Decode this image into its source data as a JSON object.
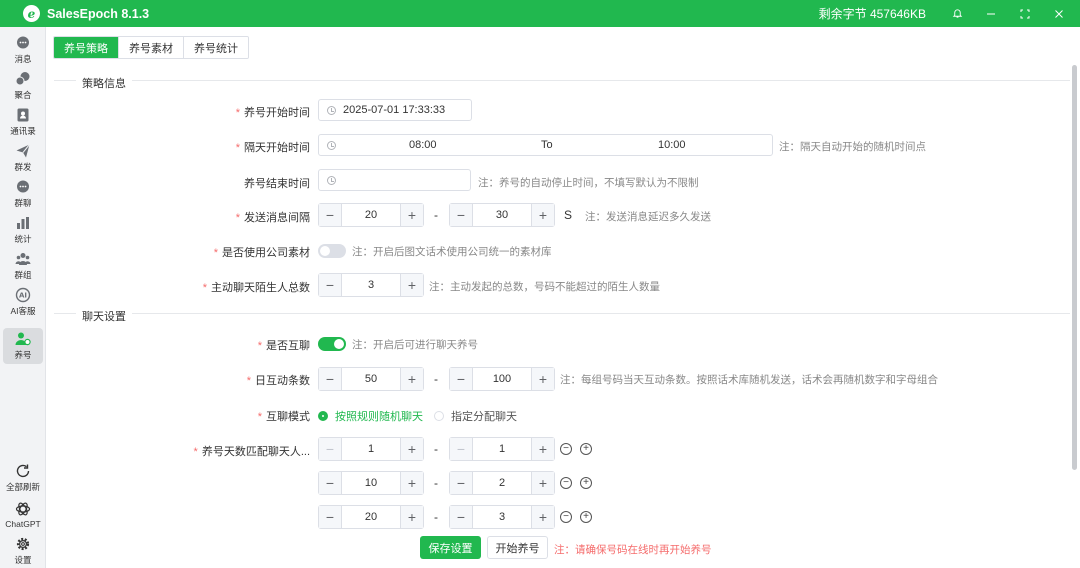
{
  "titlebar": {
    "app_title": "SalesEpoch 8.1.3",
    "logo_letter": "e",
    "bytes_label": "剩余字节",
    "bytes_value": "457646KB"
  },
  "sidebar": {
    "items": [
      {
        "label": "消息",
        "icon": "chat-bubble-icon"
      },
      {
        "label": "聚合",
        "icon": "aggregate-chat-icon"
      },
      {
        "label": "通讯录",
        "icon": "contacts-book-icon"
      },
      {
        "label": "群发",
        "icon": "send-plane-icon"
      },
      {
        "label": "群聊",
        "icon": "group-chat-icon"
      },
      {
        "label": "统计",
        "icon": "bar-chart-icon"
      },
      {
        "label": "群组",
        "icon": "people-group-icon"
      },
      {
        "label": "AI客服",
        "icon": "ai-robot-icon"
      },
      {
        "label": "养号",
        "icon": "user-add-icon"
      }
    ],
    "bottom": [
      {
        "label": "全部刷新",
        "icon": "refresh-icon"
      },
      {
        "label": "ChatGPT",
        "icon": "chatgpt-icon"
      },
      {
        "label": "设置",
        "icon": "gear-icon"
      }
    ]
  },
  "tabs": [
    "养号策略",
    "养号素材",
    "养号统计"
  ],
  "strategy": {
    "section_title": "策略信息",
    "start_time": {
      "label": "养号开始时间",
      "value": "2025-07-01 17:33:33"
    },
    "next_day": {
      "label": "隔天开始时间",
      "from": "08:00",
      "sep": "To",
      "to": "10:00",
      "note": "注：隔天自动开始的随机时间点"
    },
    "end_time": {
      "label": "养号结束时间",
      "value": "",
      "note": "注：养号的自动停止时间，不填写默认为不限制"
    },
    "interval": {
      "label": "发送消息间隔",
      "min": "20",
      "max": "30",
      "unit": "S",
      "note": "注：发送消息延迟多久发送"
    },
    "use_company": {
      "label": "是否使用公司素材",
      "enabled": false,
      "note": "注：开启后图文话术使用公司统一的素材库"
    },
    "strangers": {
      "label": "主动聊天陌生人总数",
      "value": "3",
      "note": "注：主动发起的总数，号码不能超过的陌生人数量"
    }
  },
  "chat": {
    "section_title": "聊天设置",
    "mutual": {
      "label": "是否互聊",
      "enabled": true,
      "note": "注：开启后可进行聊天养号"
    },
    "daily": {
      "label": "日互动条数",
      "min": "50",
      "max": "100",
      "note": "注：每组号码当天互动条数。按照话术库随机发送，话术会再随机数字和字母组合"
    },
    "mode": {
      "label": "互聊模式",
      "options": [
        "按照规则随机聊天",
        "指定分配聊天"
      ],
      "selected": "按照规则随机聊天"
    },
    "match": {
      "label": "养号天数匹配聊天人...",
      "rows": [
        {
          "a": "1",
          "b": "1"
        },
        {
          "a": "10",
          "b": "2"
        },
        {
          "a": "20",
          "b": "3"
        }
      ]
    }
  },
  "footer": {
    "save": "保存设置",
    "start": "开始养号",
    "note": "注：请确保号码在线时再开始养号"
  },
  "colors": {
    "accent": "#21b84f",
    "required": "#f56c6c"
  }
}
